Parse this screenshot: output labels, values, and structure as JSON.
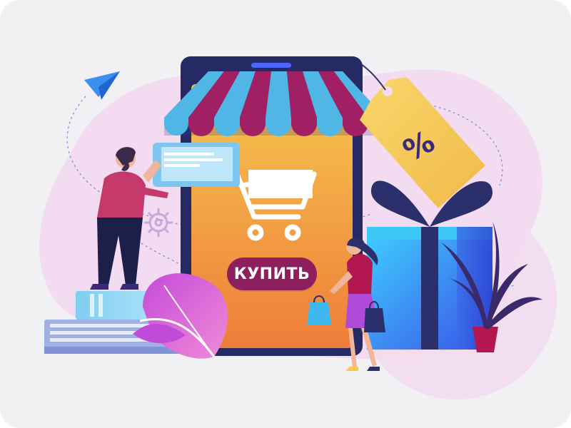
{
  "buy_button": {
    "label": "КУПИТЬ"
  },
  "discount_tag": {
    "symbol": "%"
  },
  "icons": [
    "paper-plane-icon",
    "shopping-cart-icon",
    "gear-icon",
    "percent-tag-icon",
    "gift-box-icon",
    "shopping-bag-icon",
    "plant-icon",
    "books-icon"
  ],
  "colors": {
    "frame_bg": "#f1f1f4",
    "blob": "#f2dbf0",
    "phone": "#2b2f6b",
    "screen_top": "#f7c84b",
    "screen_bottom": "#ee7d3a",
    "awning_blue": "#4fb6e6",
    "awning_magenta": "#a11f63",
    "button": "#8e1f5e",
    "tag": "#f3cf57",
    "gift": "#3e7ff0",
    "ribbon": "#2b2f6b"
  }
}
